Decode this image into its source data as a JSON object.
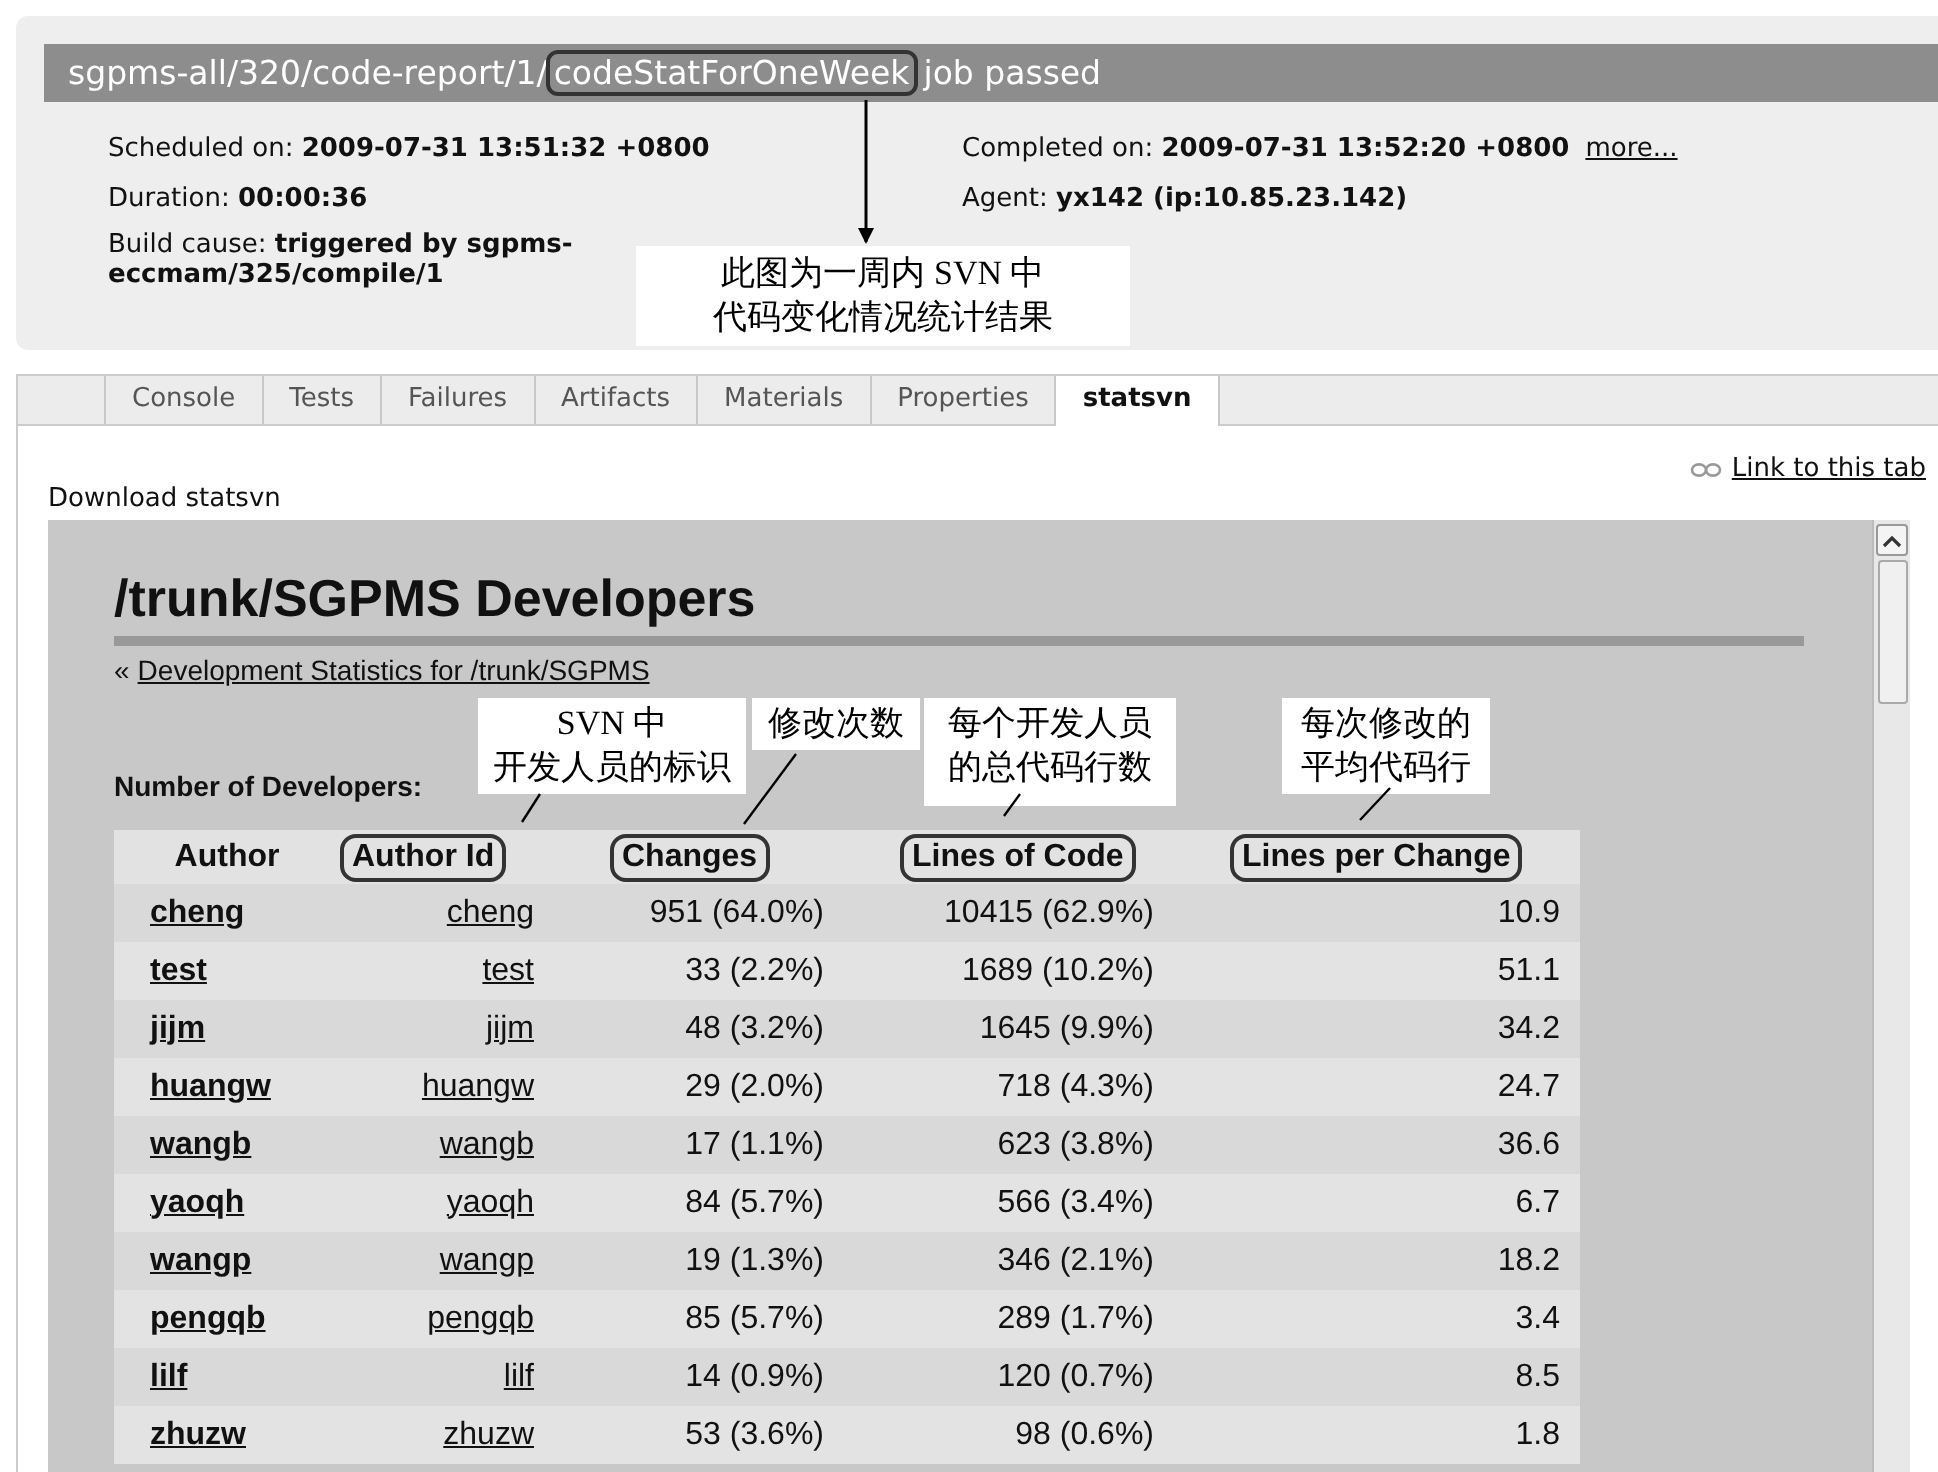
{
  "job": {
    "path": "sgpms-all/320/code-report/1/",
    "name": "codeStatForOneWeek",
    "name_circled": true,
    "status": "job passed",
    "details_left": [
      {
        "text": "Scheduled on: **2009-07-31 13:51:32 +0800**"
      },
      {
        "text": "Duration: **00:00:36**"
      },
      {
        "text": "Build cause: **triggered by sgpms-eccmam/325/compile/1**"
      }
    ],
    "details_right": [
      {
        "text": "Completed on: **2009-07-31 13:52:20 +0800**",
        "link": "more..."
      },
      {
        "text": "Agent: **yx142 (ip:10.85.23.142)**"
      }
    ]
  },
  "tabs": [
    {
      "label": "Console",
      "selected": false
    },
    {
      "label": "Tests",
      "selected": false
    },
    {
      "label": "Failures",
      "selected": false
    },
    {
      "label": "Artifacts",
      "selected": false
    },
    {
      "label": "Materials",
      "selected": false
    },
    {
      "label": "Properties",
      "selected": false
    },
    {
      "label": "statsvn",
      "selected": true
    }
  ],
  "tab_link": "Link to this tab",
  "download": "Download statsvn",
  "report": {
    "title": "/trunk/SGPMS Developers",
    "back_prefix": "«",
    "back_link": "Development Statistics for /trunk/SGPMS",
    "developers_label": "Number of Developers:",
    "table": {
      "columns": [
        {
          "label": "Author",
          "kind": "author",
          "circled": false
        },
        {
          "label": "Author Id",
          "kind": "id",
          "circled": true
        },
        {
          "label": "Changes",
          "kind": "number",
          "circled": true
        },
        {
          "label": "Lines of Code",
          "kind": "number",
          "circled": true
        },
        {
          "label": "Lines per Change",
          "kind": "number",
          "circled": true
        }
      ],
      "rows": [
        [
          "cheng",
          "cheng",
          "951 (64.0%)",
          "10415 (62.9%)",
          "10.9"
        ],
        [
          "test",
          "test",
          "33 (2.2%)",
          "1689 (10.2%)",
          "51.1"
        ],
        [
          "jijm",
          "jijm",
          "48 (3.2%)",
          "1645 (9.9%)",
          "34.2"
        ],
        [
          "huangw",
          "huangw",
          "29 (2.0%)",
          "718 (4.3%)",
          "24.7"
        ],
        [
          "wangb",
          "wangb",
          "17 (1.1%)",
          "623 (3.8%)",
          "36.6"
        ],
        [
          "yaoqh",
          "yaoqh",
          "84 (5.7%)",
          "566 (3.4%)",
          "6.7"
        ],
        [
          "wangp",
          "wangp",
          "19 (1.3%)",
          "346 (2.1%)",
          "18.2"
        ],
        [
          "pengqb",
          "pengqb",
          "85 (5.7%)",
          "289 (1.7%)",
          "3.4"
        ],
        [
          "lilf",
          "lilf",
          "14 (0.9%)",
          "120 (0.7%)",
          "8.5"
        ],
        [
          "zhuzw",
          "zhuzw",
          "53 (3.6%)",
          "98 (0.6%)",
          "1.8"
        ]
      ]
    }
  },
  "annotations": [
    {
      "lines": [
        "此图为一周内 SVN 中",
        "代码变化情况统计结果"
      ],
      "kind": "arrow"
    },
    {
      "lines": [
        "SVN 中",
        "开发人员的标识"
      ],
      "kind": "line"
    },
    {
      "lines": [
        "修改次数"
      ],
      "kind": "line"
    },
    {
      "lines": [
        "每个开发人员",
        "的总代码行数"
      ],
      "kind": "line"
    },
    {
      "lines": [
        "每次修改的",
        "平均代码行"
      ],
      "kind": "line"
    }
  ]
}
